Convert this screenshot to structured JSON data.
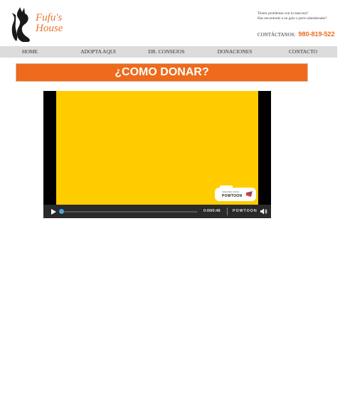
{
  "logo": {
    "line1": "Fufu's",
    "line2": "House"
  },
  "contact": {
    "question1": "Tienes problemas con tu mascota?",
    "question2": "Has encontrado a un gato o perro abandonado?",
    "label": "CONTÁCTANOS:",
    "phone": "980-819-522"
  },
  "nav": {
    "items": [
      {
        "label": "HOME"
      },
      {
        "label": "ADOPTA AQUI"
      },
      {
        "label": "DR. CONSEJOS"
      },
      {
        "label": "DONACIONES"
      },
      {
        "label": "CONTACTO"
      }
    ]
  },
  "banner": {
    "title": "¿COMO DONAR?"
  },
  "video": {
    "time": "0:00/0:48",
    "brand": "POWTOON",
    "watermark_small": "CREATED USING",
    "watermark_name": "POWTOON",
    "progress": 0
  },
  "colors": {
    "accent": "#ee6a1c",
    "video_frame": "#ffcc00",
    "nav_bg": "#dcdcdc"
  }
}
